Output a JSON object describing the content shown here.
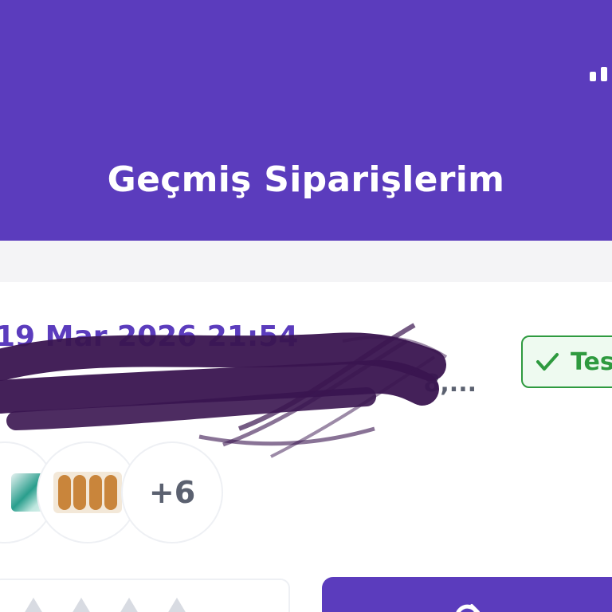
{
  "header": {
    "title": "Geçmiş Siparişlerim"
  },
  "order": {
    "date": "19 Mar 2026 21:54",
    "address_visible": "8,...",
    "status_label": "Tes",
    "more_items": "+6"
  },
  "colors": {
    "brand": "#5b3cbd",
    "status_green": "#2e9a3f",
    "text_gray": "#5b6170"
  }
}
